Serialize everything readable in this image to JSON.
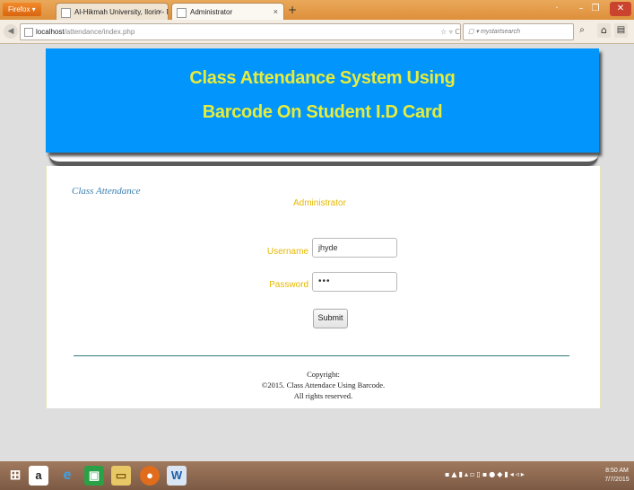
{
  "browser": {
    "app_button": "Firefox",
    "tabs": [
      {
        "label": "Al-Hikmah University, Ilorin - Nigeria:..."
      },
      {
        "label": "Administrator"
      }
    ],
    "new_tab": "+",
    "address": {
      "host": "localhost",
      "path": "/attendance/index.php"
    },
    "search_engine": "mystartsearch"
  },
  "page": {
    "banner": {
      "line1": "Class Attendance System Using",
      "line2": "Barcode On Student I.D Card"
    },
    "side_link": "Class Attendance",
    "form": {
      "heading": "Administrator",
      "username_label": "Username",
      "username_value": "jhyde",
      "password_label": "Password",
      "password_value": "•••",
      "submit_label": "Submit"
    },
    "footer": {
      "line1": "Copyright:",
      "line2": "©2015. Class Attendace Using Barcode.",
      "line3": "All rights reserved."
    }
  },
  "taskbar": {
    "clock_time": "8:50 AM",
    "clock_date": "7/7/2015"
  },
  "colors": {
    "banner_bg": "#0295fb",
    "banner_text": "#e6ec3c",
    "form_label": "#e6b800",
    "side_link": "#3a7fb0"
  }
}
